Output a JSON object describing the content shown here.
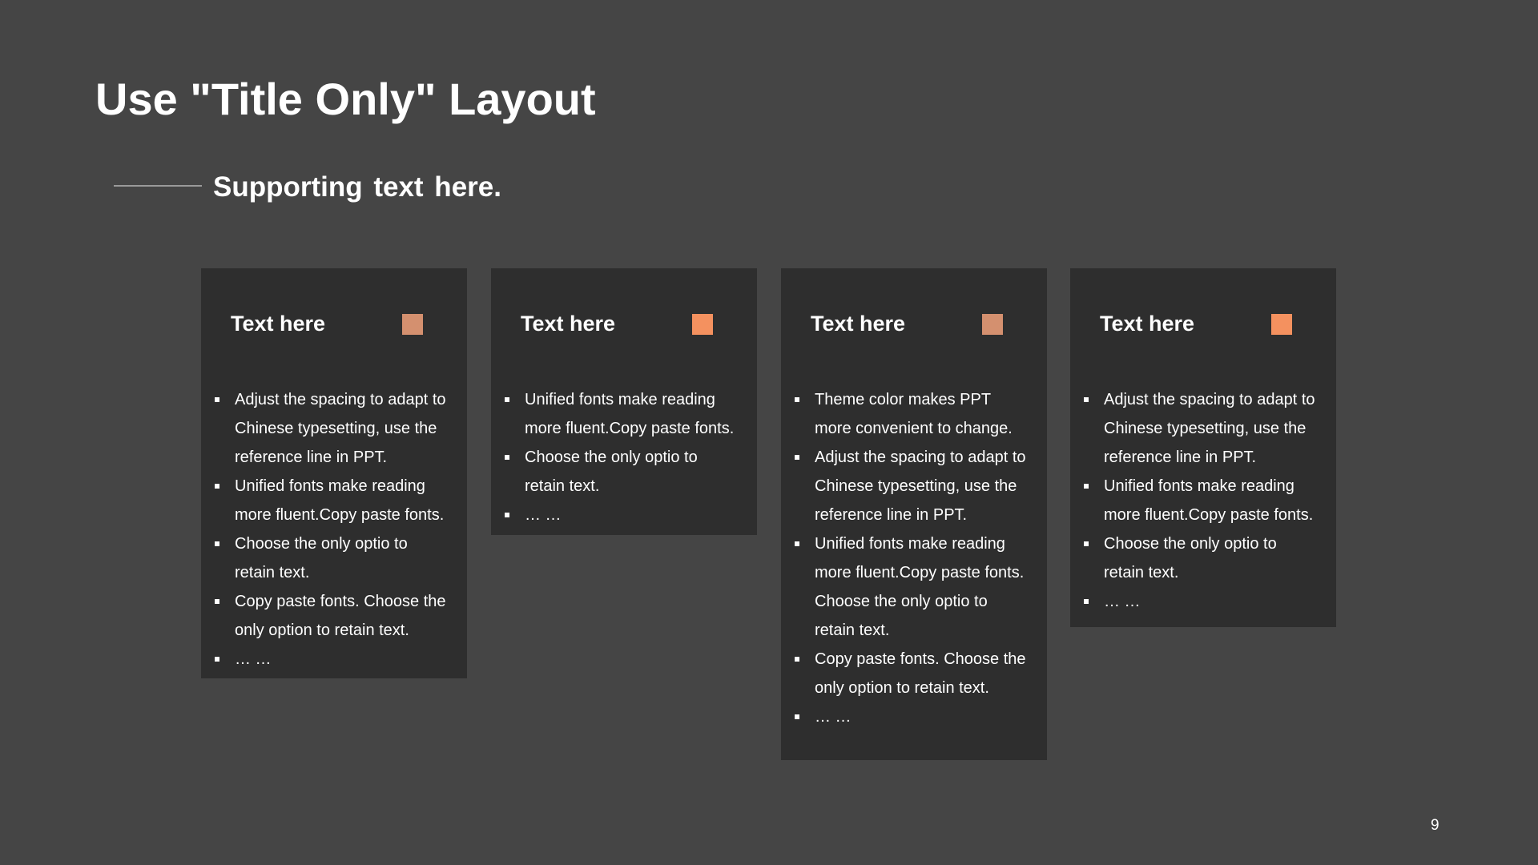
{
  "slide": {
    "title": "Use \"Title Only\" Layout",
    "subtitle": "Supporting text here.",
    "page_number": "9"
  },
  "cards": [
    {
      "title": "Text here",
      "accent_color": "#d4906f",
      "bullets": [
        "Adjust the spacing to adapt to Chinese typesetting, use the reference line in PPT.",
        "Unified fonts make reading more fluent.Copy paste fonts.",
        "Choose the only optio to retain text.",
        "Copy paste fonts. Choose the only option to retain text.",
        "… …"
      ]
    },
    {
      "title": "Text here",
      "accent_color": "#f4915f",
      "bullets": [
        "Unified fonts make reading more fluent.Copy paste fonts.",
        "Choose the only optio to retain text.",
        "… …"
      ]
    },
    {
      "title": "Text here",
      "accent_color": "#d4906f",
      "bullets": [
        "Theme color makes PPT more convenient to change.",
        "Adjust the spacing to adapt to Chinese typesetting, use the reference line in PPT.",
        "Unified fonts make reading more fluent.Copy paste fonts. Choose the only optio to retain text.",
        "Copy paste fonts. Choose the only option to retain text.",
        "… …"
      ]
    },
    {
      "title": "Text here",
      "accent_color": "#f4915f",
      "bullets": [
        "Adjust the spacing to adapt to Chinese typesetting, use the reference line in PPT.",
        "Unified fonts make reading more fluent.Copy paste fonts.",
        "Choose the only optio to retain text.",
        "… …"
      ]
    }
  ]
}
